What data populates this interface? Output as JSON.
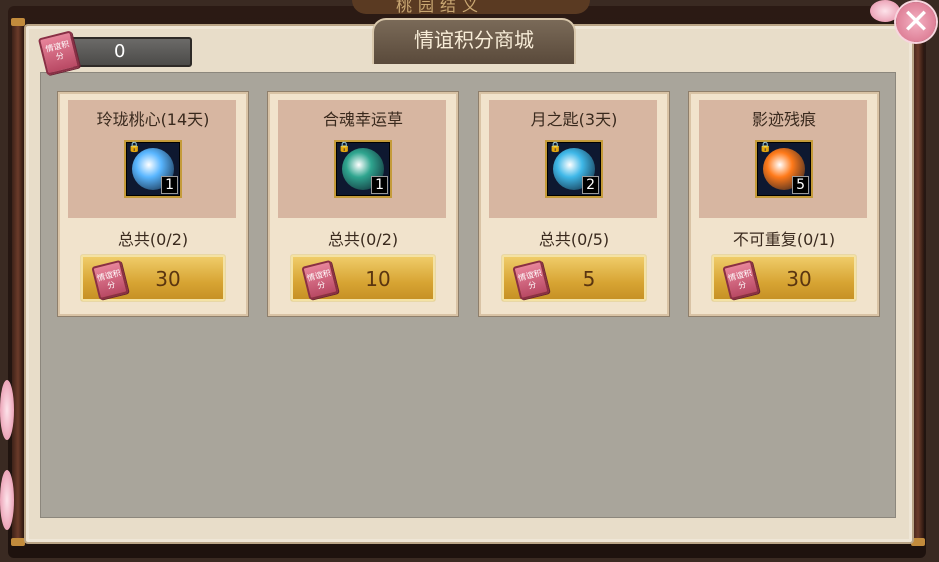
{
  "window": {
    "title": "情谊积分商城",
    "close_icon": "close-icon"
  },
  "background_banner": "桃园结义",
  "points": {
    "icon": "friendship-points-icon",
    "icon_text": "情谊积分",
    "value": "0"
  },
  "colors": {
    "panel": "#e8ddc9",
    "card": "#f1e3cc",
    "card_top": "#d7b6a1",
    "button": "#d7a433",
    "content_bg": "#a9a59b"
  },
  "items": [
    {
      "name": "玲珑桃心(14天)",
      "count": "1",
      "limit": "总共(0/2)",
      "price": "30",
      "icon": "blue-heart-icon",
      "art_color": "#59b6ff"
    },
    {
      "name": "合魂幸运草",
      "count": "1",
      "limit": "总共(0/2)",
      "price": "10",
      "icon": "lucky-clover-icon",
      "art_color": "#2fa58f"
    },
    {
      "name": "月之匙(3天)",
      "count": "2",
      "limit": "总共(0/5)",
      "price": "5",
      "icon": "moon-key-icon",
      "art_color": "#3fb8e8"
    },
    {
      "name": "影迹残痕",
      "count": "5",
      "limit": "不可重复(0/1)",
      "price": "30",
      "icon": "shadow-trace-icon",
      "art_color": "#ff7a1a"
    }
  ]
}
